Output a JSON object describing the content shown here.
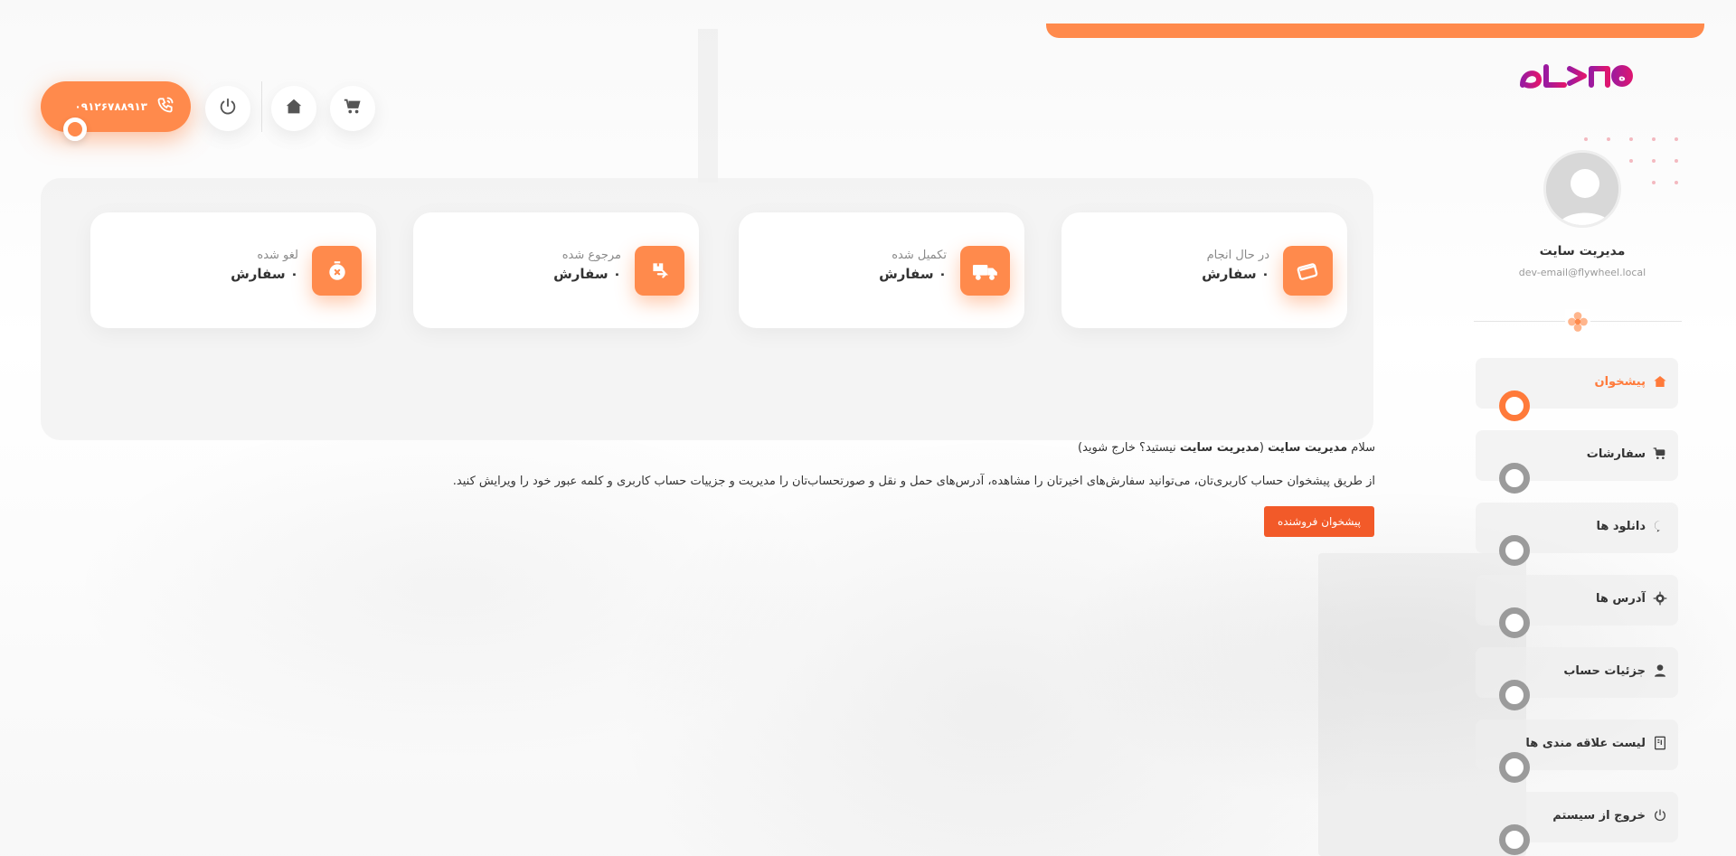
{
  "brand": {
    "logo_text": "کاوه",
    "accent": "#ff8a4c",
    "logo_color": "#c0188a"
  },
  "header": {
    "phone": "۰۹۱۲۶۷۸۸۹۱۳",
    "icons": [
      "phone-icon",
      "power-icon",
      "home-icon",
      "cart-icon"
    ]
  },
  "stats": [
    {
      "label": "در حال انجام",
      "value": "۰ سفارش",
      "icon": "card-icon"
    },
    {
      "label": "تکمیل شده",
      "value": "۰ سفارش",
      "icon": "truck-icon"
    },
    {
      "label": "مرجوع شده",
      "value": "۰ سفارش",
      "icon": "return-box-icon"
    },
    {
      "label": "لغو شده",
      "value": "۰ سفارش",
      "icon": "cancel-icon"
    }
  ],
  "intro": {
    "hello": "سلام",
    "user_bold": "مدیریت سایت",
    "not_user_prefix": "(",
    "not_user_bold": "مدیریت سایت",
    "not_user_suffix": " نیستید؟ ",
    "logout_link": "خارج شوید",
    "logout_suffix": ")",
    "description": "از طریق پیشخوان حساب کاربری‌تان، می‌توانید سفارش‌های اخیرتان را مشاهده، آدرس‌های حمل و نقل و صورتحساب‌تان را مدیریت و جزییات حساب کاربری و کلمه عبور خود را ویرایش کنید.",
    "vendor_button": "پیشخوان فروشنده"
  },
  "user": {
    "name": "مدیریت سایت",
    "email": "dev-email@flywheel.local"
  },
  "nav": [
    {
      "label": "پیشخوان",
      "icon": "home-icon",
      "active": true
    },
    {
      "label": "سفارشات",
      "icon": "cart-icon",
      "active": false
    },
    {
      "label": "دانلود ها",
      "icon": "chat-icon",
      "active": false
    },
    {
      "label": "آدرس ها",
      "icon": "gear-icon",
      "active": false
    },
    {
      "label": "جزئیات حساب",
      "icon": "user-icon",
      "active": false
    },
    {
      "label": "لیست علاقه مندی ها",
      "icon": "wishlist-icon",
      "active": false
    },
    {
      "label": "خروج از سیستم",
      "icon": "power-icon",
      "active": false
    }
  ]
}
